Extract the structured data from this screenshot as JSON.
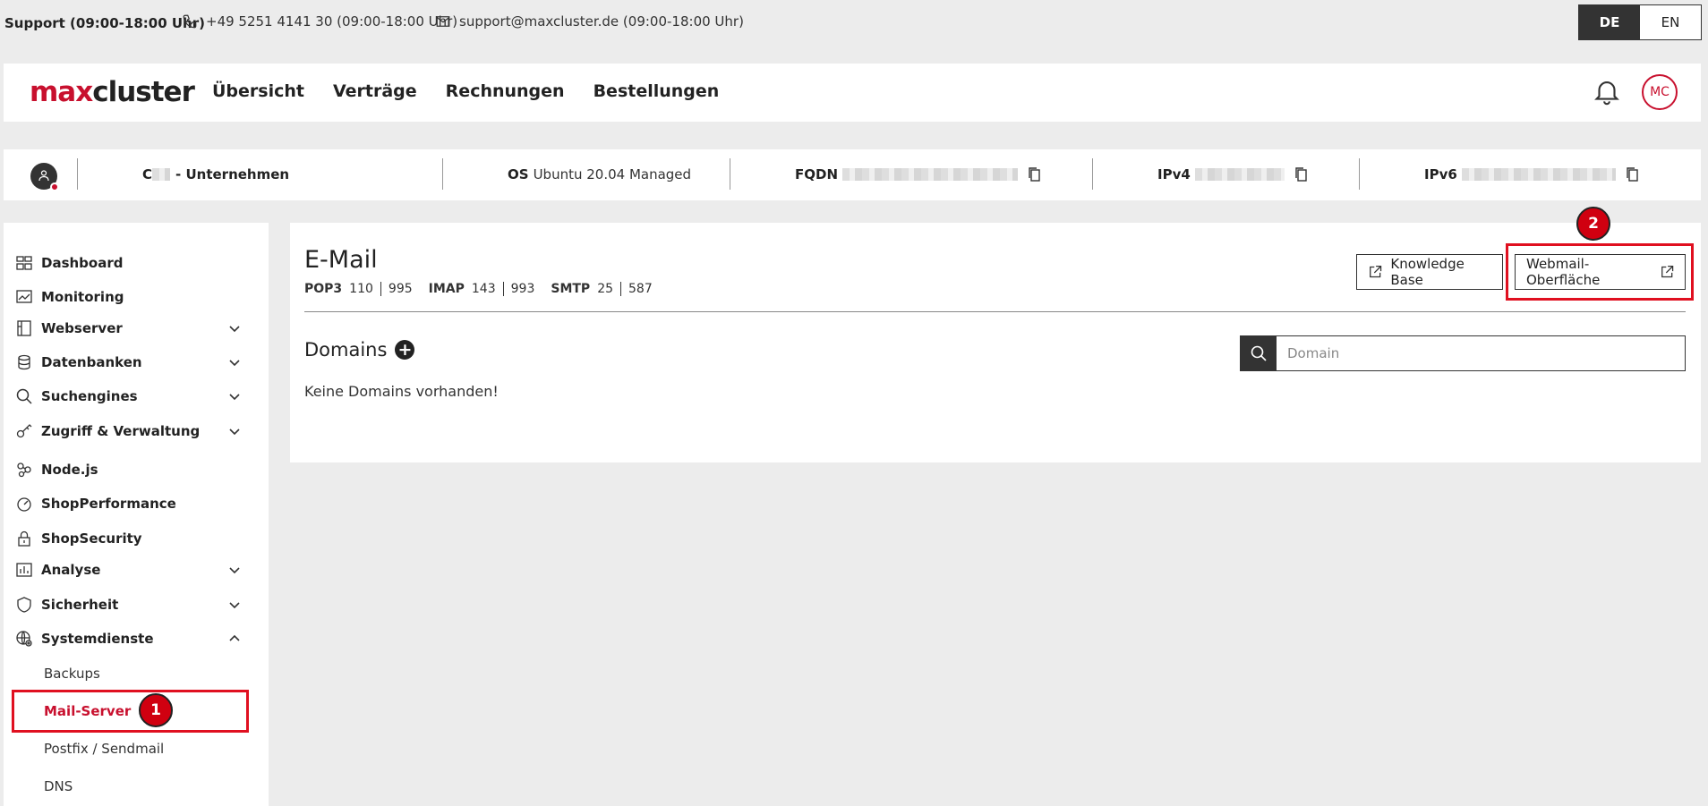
{
  "support": {
    "label": "Support (09:00-18:00 Uhr)",
    "phone": "+49 5251 4141 30 (09:00-18:00 Uhr)",
    "email": "support@maxcluster.de (09:00-18:00 Uhr)"
  },
  "language": {
    "options": [
      "DE",
      "EN"
    ],
    "active": "DE"
  },
  "header": {
    "logo_max": "max",
    "logo_cluster": "cluster",
    "nav": [
      "Übersicht",
      "Verträge",
      "Rechnungen",
      "Bestellungen"
    ],
    "user_initials": "MC"
  },
  "server": {
    "name_prefix": "C",
    "name_suffix": "- Unternehmen",
    "os_label": "OS",
    "os_value": "Ubuntu 20.04 Managed",
    "fqdn_label": "FQDN",
    "ipv4_label": "IPv4",
    "ipv6_label": "IPv6"
  },
  "sidebar": {
    "items": [
      {
        "label": "Dashboard",
        "icon": "dashboard-icon",
        "expandable": false
      },
      {
        "label": "Monitoring",
        "icon": "monitoring-icon",
        "expandable": false
      },
      {
        "label": "Webserver",
        "icon": "webserver-icon",
        "expandable": true
      },
      {
        "label": "Datenbanken",
        "icon": "database-icon",
        "expandable": true
      },
      {
        "label": "Suchengines",
        "icon": "search-icon",
        "expandable": true
      },
      {
        "label": "Zugriff & Verwaltung",
        "icon": "key-icon",
        "expandable": true
      },
      {
        "label": "Node.js",
        "icon": "nodejs-icon",
        "expandable": false
      },
      {
        "label": "ShopPerformance",
        "icon": "speedometer-icon",
        "expandable": false
      },
      {
        "label": "ShopSecurity",
        "icon": "lock-icon",
        "expandable": false
      },
      {
        "label": "Analyse",
        "icon": "chart-icon",
        "expandable": true
      },
      {
        "label": "Sicherheit",
        "icon": "shield-icon",
        "expandable": true
      },
      {
        "label": "Systemdienste",
        "icon": "system-services-icon",
        "expandable": true,
        "expanded": true
      }
    ],
    "subitems": [
      "Backups",
      "Mail-Server",
      "Postfix / Sendmail",
      "DNS"
    ],
    "active_subitem": "Mail-Server"
  },
  "main": {
    "title": "E-Mail",
    "ports": [
      {
        "name": "POP3",
        "values": [
          "110",
          "995"
        ]
      },
      {
        "name": "IMAP",
        "values": [
          "143",
          "993"
        ]
      },
      {
        "name": "SMTP",
        "values": [
          "25",
          "587"
        ]
      }
    ],
    "knowledge_base_label": "Knowledge Base",
    "webmail_label": "Webmail-Oberfläche",
    "domains_title": "Domains",
    "search_placeholder": "Domain",
    "empty_message": "Keine Domains vorhanden!"
  },
  "annotations": {
    "badge1": "1",
    "badge2": "2",
    "highlight_color": "#e01020"
  },
  "colors": {
    "brand": "#c8102e",
    "dark": "#333333"
  }
}
